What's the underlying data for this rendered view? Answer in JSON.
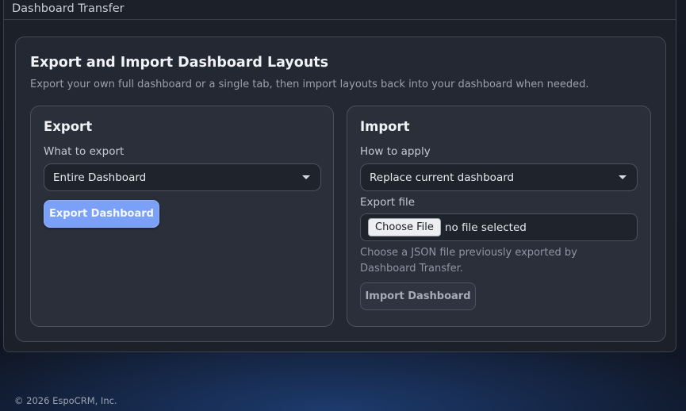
{
  "panel": {
    "title": "Dashboard Transfer"
  },
  "card": {
    "title": "Export and Import Dashboard Layouts",
    "subtitle": "Export your own full dashboard or a single tab, then import layouts back into your dashboard when needed."
  },
  "export": {
    "title": "Export",
    "what_label": "What to export",
    "what_value": "Entire Dashboard",
    "button_label": "Export Dashboard"
  },
  "import": {
    "title": "Import",
    "apply_label": "How to apply",
    "apply_value": "Replace current dashboard",
    "file_label": "Export file",
    "file_button": "Choose File",
    "file_status": "no file selected",
    "help_text": "Choose a JSON file previously exported by Dashboard Transfer.",
    "button_label": "Import Dashboard"
  },
  "footer": {
    "copyright": "© 2026 EspoCRM, Inc."
  },
  "colors": {
    "primary_button": "#7aa0f8",
    "panel_background": "#1c2029",
    "card_background": "#232833"
  },
  "icons": {
    "select_caret": "chevron-down-icon"
  }
}
